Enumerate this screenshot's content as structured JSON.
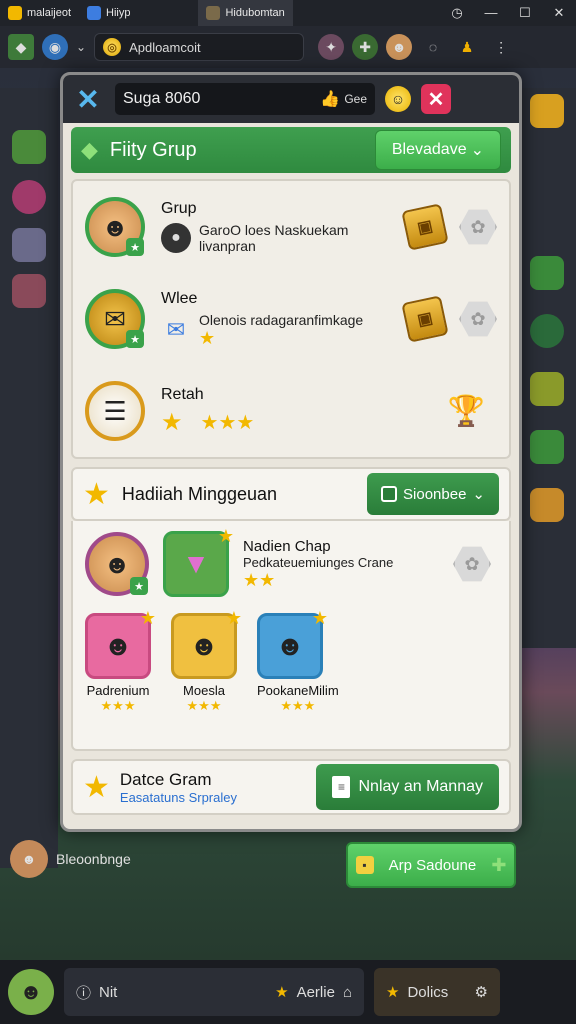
{
  "titlebar": {
    "tabs": [
      {
        "label": "malaijeot"
      },
      {
        "label": "Hiiyp"
      },
      {
        "label": "Hidubomtan"
      }
    ]
  },
  "toolbar": {
    "address": "Apdloamcoit"
  },
  "modal": {
    "header_field": "Suga 8060",
    "header_button": "Gee",
    "section": {
      "title": "Fiity Grup",
      "button": "Blevadave"
    },
    "rows": [
      {
        "title": "Grup",
        "sub_line1": "GaroO loes Naskuekam",
        "sub_line2": "livanpran"
      },
      {
        "title": "Wlee",
        "sub_line1": "Olenois radagaranfimkage"
      },
      {
        "title": "Retah"
      }
    ],
    "weekly": {
      "title": "Hadiiah Minggeuan",
      "button": "Sioonbee",
      "featured_title": "Nadien Chap",
      "featured_sub": "Pedkateuemiunges Crane",
      "tiles": [
        {
          "name": "Padrenium"
        },
        {
          "name": "Moesla"
        },
        {
          "name": "PookaneMilim"
        }
      ]
    },
    "footer": {
      "title": "Datce Gram",
      "subtitle": "Easatatuns Srpraley",
      "button": "Nnlay an Mannay"
    }
  },
  "outside_button": "Arp Sadoune",
  "side_user": "Bleoonbnge",
  "bottom": {
    "field_left": "Nit",
    "field_mid": "Aerlie",
    "field_right": "Dolics"
  },
  "colors": {
    "accent_green": "#3cae4a",
    "close_red": "#e0335b",
    "star_gold": "#f2b800"
  }
}
